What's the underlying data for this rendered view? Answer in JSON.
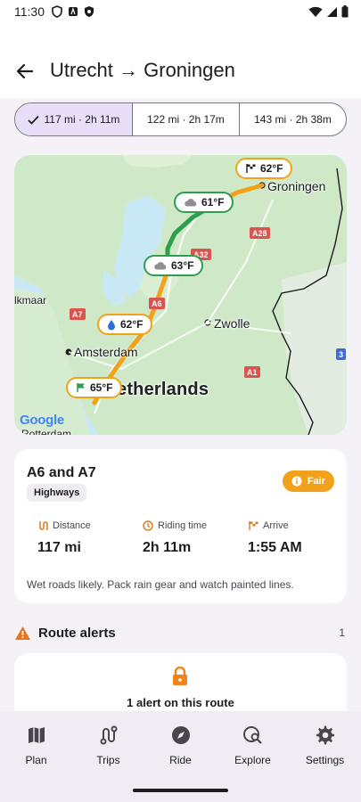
{
  "status_bar": {
    "time": "11:30"
  },
  "header": {
    "title": "Utrecht → Groningen"
  },
  "route_options": [
    {
      "label": "117 mi · 2h 11m",
      "selected": true
    },
    {
      "label": "122 mi · 2h 17m",
      "selected": false
    },
    {
      "label": "143 mi · 2h 38m",
      "selected": false
    }
  ],
  "map": {
    "weather_pills": [
      {
        "temp": "62°F",
        "icon": "checkered-flag-icon",
        "color": "orange"
      },
      {
        "temp": "61°F",
        "icon": "cloud-icon",
        "color": "green"
      },
      {
        "temp": "63°F",
        "icon": "cloud-icon",
        "color": "green"
      },
      {
        "temp": "62°F",
        "icon": "raindrop-icon",
        "color": "orange"
      },
      {
        "temp": "65°F",
        "icon": "start-flag-icon",
        "color": "orange"
      }
    ],
    "labels": {
      "groningen": "Groningen",
      "zwolle": "Zwolle",
      "amsterdam": "Amsterdam",
      "netherlands": "etherlands",
      "alkmaar": "lkmaar",
      "rotterdam": "Rotterdam"
    },
    "road_shields": [
      "A28",
      "A32",
      "A6",
      "A7",
      "A1",
      "3"
    ],
    "attribution": "Google",
    "colors": {
      "route_green": "#2e9e4e",
      "route_orange": "#f2a21a"
    }
  },
  "route_card": {
    "name": "A6 and A7",
    "tag": "Highways",
    "condition": "Fair",
    "stats": [
      {
        "label": "Distance",
        "value": "117 mi",
        "icon": "distance-icon"
      },
      {
        "label": "Riding time",
        "value": "2h 11m",
        "icon": "clock-icon"
      },
      {
        "label": "Arrive",
        "value": "1:55 AM",
        "icon": "checkered-flag-icon"
      }
    ],
    "note": "Wet roads likely. Pack rain gear and watch painted lines."
  },
  "alerts": {
    "title": "Route alerts",
    "count": "1",
    "summary": "1 alert on this route"
  },
  "nav": [
    {
      "label": "Plan",
      "icon": "map-icon"
    },
    {
      "label": "Trips",
      "icon": "route-icon"
    },
    {
      "label": "Ride",
      "icon": "compass-icon"
    },
    {
      "label": "Explore",
      "icon": "explore-search-icon"
    },
    {
      "label": "Settings",
      "icon": "gear-icon"
    }
  ],
  "accent_colors": {
    "selected_segment": "#e8def8",
    "warning": "#f2a21a"
  }
}
